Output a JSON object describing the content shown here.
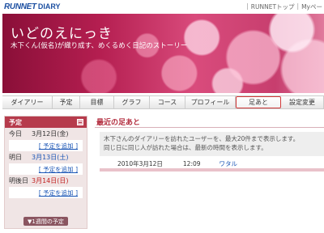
{
  "header": {
    "logo_text": "RUNNET",
    "logo_sub": "DIARY",
    "links": [
      "RUNNETトップ",
      "Myペー"
    ]
  },
  "banner": {
    "title": "いどのえにっき",
    "subtitle": "木下くん(仮名)が織り成す、めくるめく日記のストーリー"
  },
  "nav": {
    "tabs": [
      "ダイアリー",
      "予定",
      "目標",
      "グラフ",
      "コース",
      "プロフィール",
      "足あと",
      "設定変更"
    ],
    "active_index": 6
  },
  "schedule": {
    "title": "予定",
    "days": [
      {
        "label": "今日",
        "date": "3月12日(金)",
        "add": "[ 予定を追加 ]"
      },
      {
        "label": "明日",
        "date": "3月13日(土)",
        "add": "[ 予定を追加 ]"
      },
      {
        "label": "明後日",
        "date": "3月14日(日)",
        "add": "[ 予定を追加 ]"
      }
    ],
    "week_button": "▼1週間の予定"
  },
  "footprints": {
    "title": "最近の足あと",
    "info_line1": "木下さんのダイアリーを訪れたユーザーを、最大20件まで表示します。",
    "info_line2": "同じ日に同じ人が訪れた場合は、最新の時間を表示します。",
    "entries": [
      {
        "date": "2010年3月12日",
        "time": "12:09",
        "user": "ワタル"
      }
    ]
  },
  "colors": {
    "accent": "#b63b4c",
    "link": "#1a55b5",
    "saturday": "#1a55b5",
    "sunday": "#c02020"
  }
}
